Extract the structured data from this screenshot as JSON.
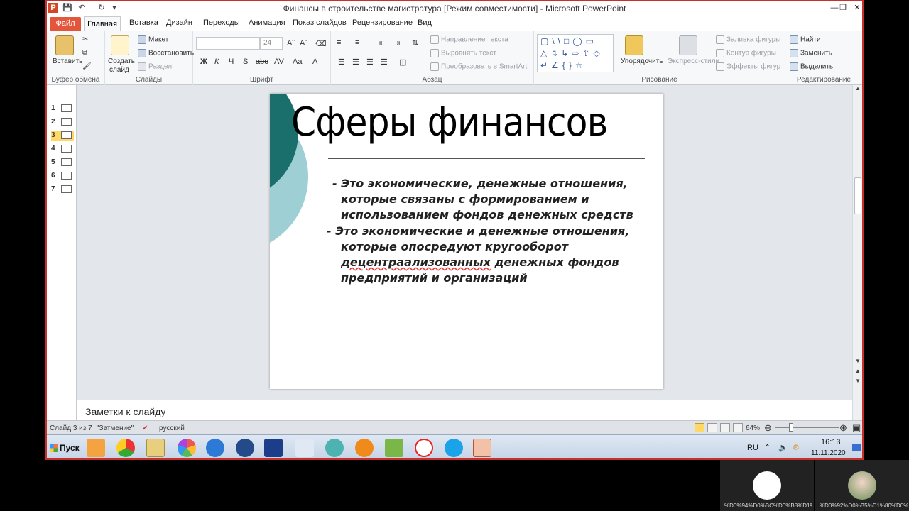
{
  "window": {
    "title": "Финансы в строительстве магистратура [Режим совместимости] - Microsoft PowerPoint"
  },
  "tabs": [
    "Файл",
    "Главная",
    "Вставка",
    "Дизайн",
    "Переходы",
    "Анимация",
    "Показ слайдов",
    "Рецензирование",
    "Вид"
  ],
  "ribbon": {
    "clipboard": {
      "paste": "Вставить",
      "label": "Буфер обмена"
    },
    "slides": {
      "create": "Создать",
      "create2": "слайд",
      "layout": "Макет",
      "reset": "Восстановить",
      "section": "Раздел",
      "label": "Слайды"
    },
    "font": {
      "size": "24",
      "label": "Шрифт"
    },
    "paragraph": {
      "text_direction": "Направление текста",
      "align_text": "Выровнять текст",
      "smartart": "Преобразовать в SmartArt",
      "label": "Абзац"
    },
    "drawing": {
      "arrange": "Упорядочить",
      "quick_styles": "Экспресс-стили",
      "fill": "Заливка фигуры",
      "outline": "Контур фигуры",
      "effects": "Эффекты фигур",
      "label": "Рисование"
    },
    "editing": {
      "find": "Найти",
      "replace": "Заменить",
      "select": "Выделить",
      "label": "Редактирование"
    }
  },
  "thumbnails": [
    "1",
    "2",
    "3",
    "4",
    "5",
    "6",
    "7"
  ],
  "slide": {
    "title": "Сферы финансов",
    "bullet1_line1": "- Это экономические, денежные отношения,",
    "bullet1_line2": "которые связаны с формированием и",
    "bullet1_line3": "использованием фондов денежных средств",
    "bullet2_line1": "- Это экономические и денежные отношения,",
    "bullet2_line2": "которые опосредуют кругооборот",
    "bullet2_line3a": "децентраализованных",
    "bullet2_line3b": " денежных фондов",
    "bullet2_line4": "предприятий и организаций"
  },
  "notes": {
    "placeholder": "Заметки к слайду"
  },
  "status": {
    "slide": "Слайд 3 из 7",
    "theme": "\"Затмение\"",
    "lang": "русский",
    "zoom": "64%"
  },
  "taskbar": {
    "start": "Пуск",
    "lang": "RU",
    "time": "16:13",
    "date": "11.11.2020"
  },
  "video": {
    "label1": "%D0%94%D0%BC%D0%B8%D1%8...",
    "label2": "%D0%92%D0%B5%D1%80%D0%80..."
  }
}
